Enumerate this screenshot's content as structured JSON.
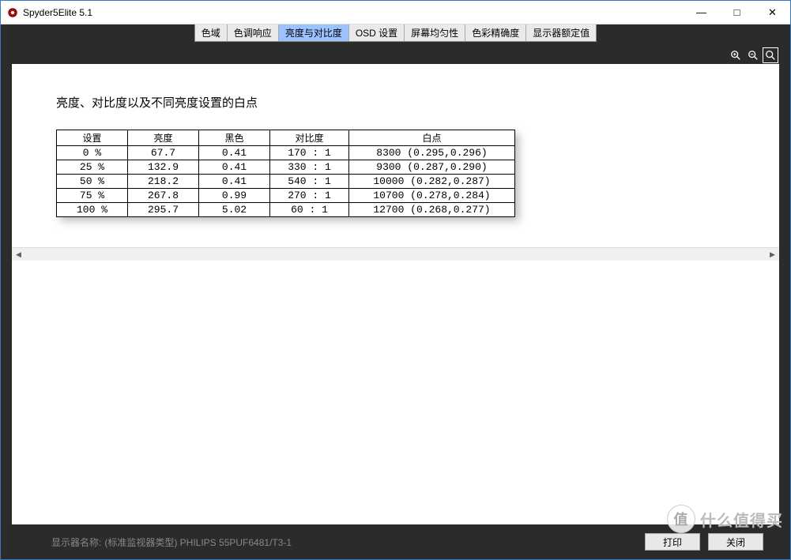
{
  "window": {
    "title": "Spyder5Elite 5.1",
    "min": "—",
    "max": "□",
    "close": "✕"
  },
  "tabs": {
    "domain": "色域",
    "tone": "色调响应",
    "brightness": "亮度与对比度",
    "osd": "OSD 设置",
    "uniformity": "屏幕均匀性",
    "accuracy": "色彩精确度",
    "rated": "显示器额定值"
  },
  "page_title": "亮度、对比度以及不同亮度设置的白点",
  "headers": {
    "setting": "设置",
    "brightness": "亮度",
    "black": "黑色",
    "contrast": "对比度",
    "white": "白点"
  },
  "rows": [
    {
      "setting": "0 %",
      "bright": "67.7",
      "black": "0.41",
      "contrast": "170 : 1",
      "white": "8300 (0.295,0.296)"
    },
    {
      "setting": "25 %",
      "bright": "132.9",
      "black": "0.41",
      "contrast": "330 : 1",
      "white": "9300 (0.287,0.290)"
    },
    {
      "setting": "50 %",
      "bright": "218.2",
      "black": "0.41",
      "contrast": "540 : 1",
      "white": "10000 (0.282,0.287)"
    },
    {
      "setting": "75 %",
      "bright": "267.8",
      "black": "0.99",
      "contrast": "270 : 1",
      "white": "10700 (0.278,0.284)"
    },
    {
      "setting": "100 %",
      "bright": "295.7",
      "black": "5.02",
      "contrast": "60 : 1",
      "white": "12700 (0.268,0.277)"
    }
  ],
  "footer": {
    "label": "显示器名称:",
    "value": "(标准监视器类型) PHILIPS 55PUF6481/T3-1",
    "print": "打印",
    "close": "关闭"
  },
  "watermark": {
    "circle": "值",
    "text": "什么值得买"
  }
}
